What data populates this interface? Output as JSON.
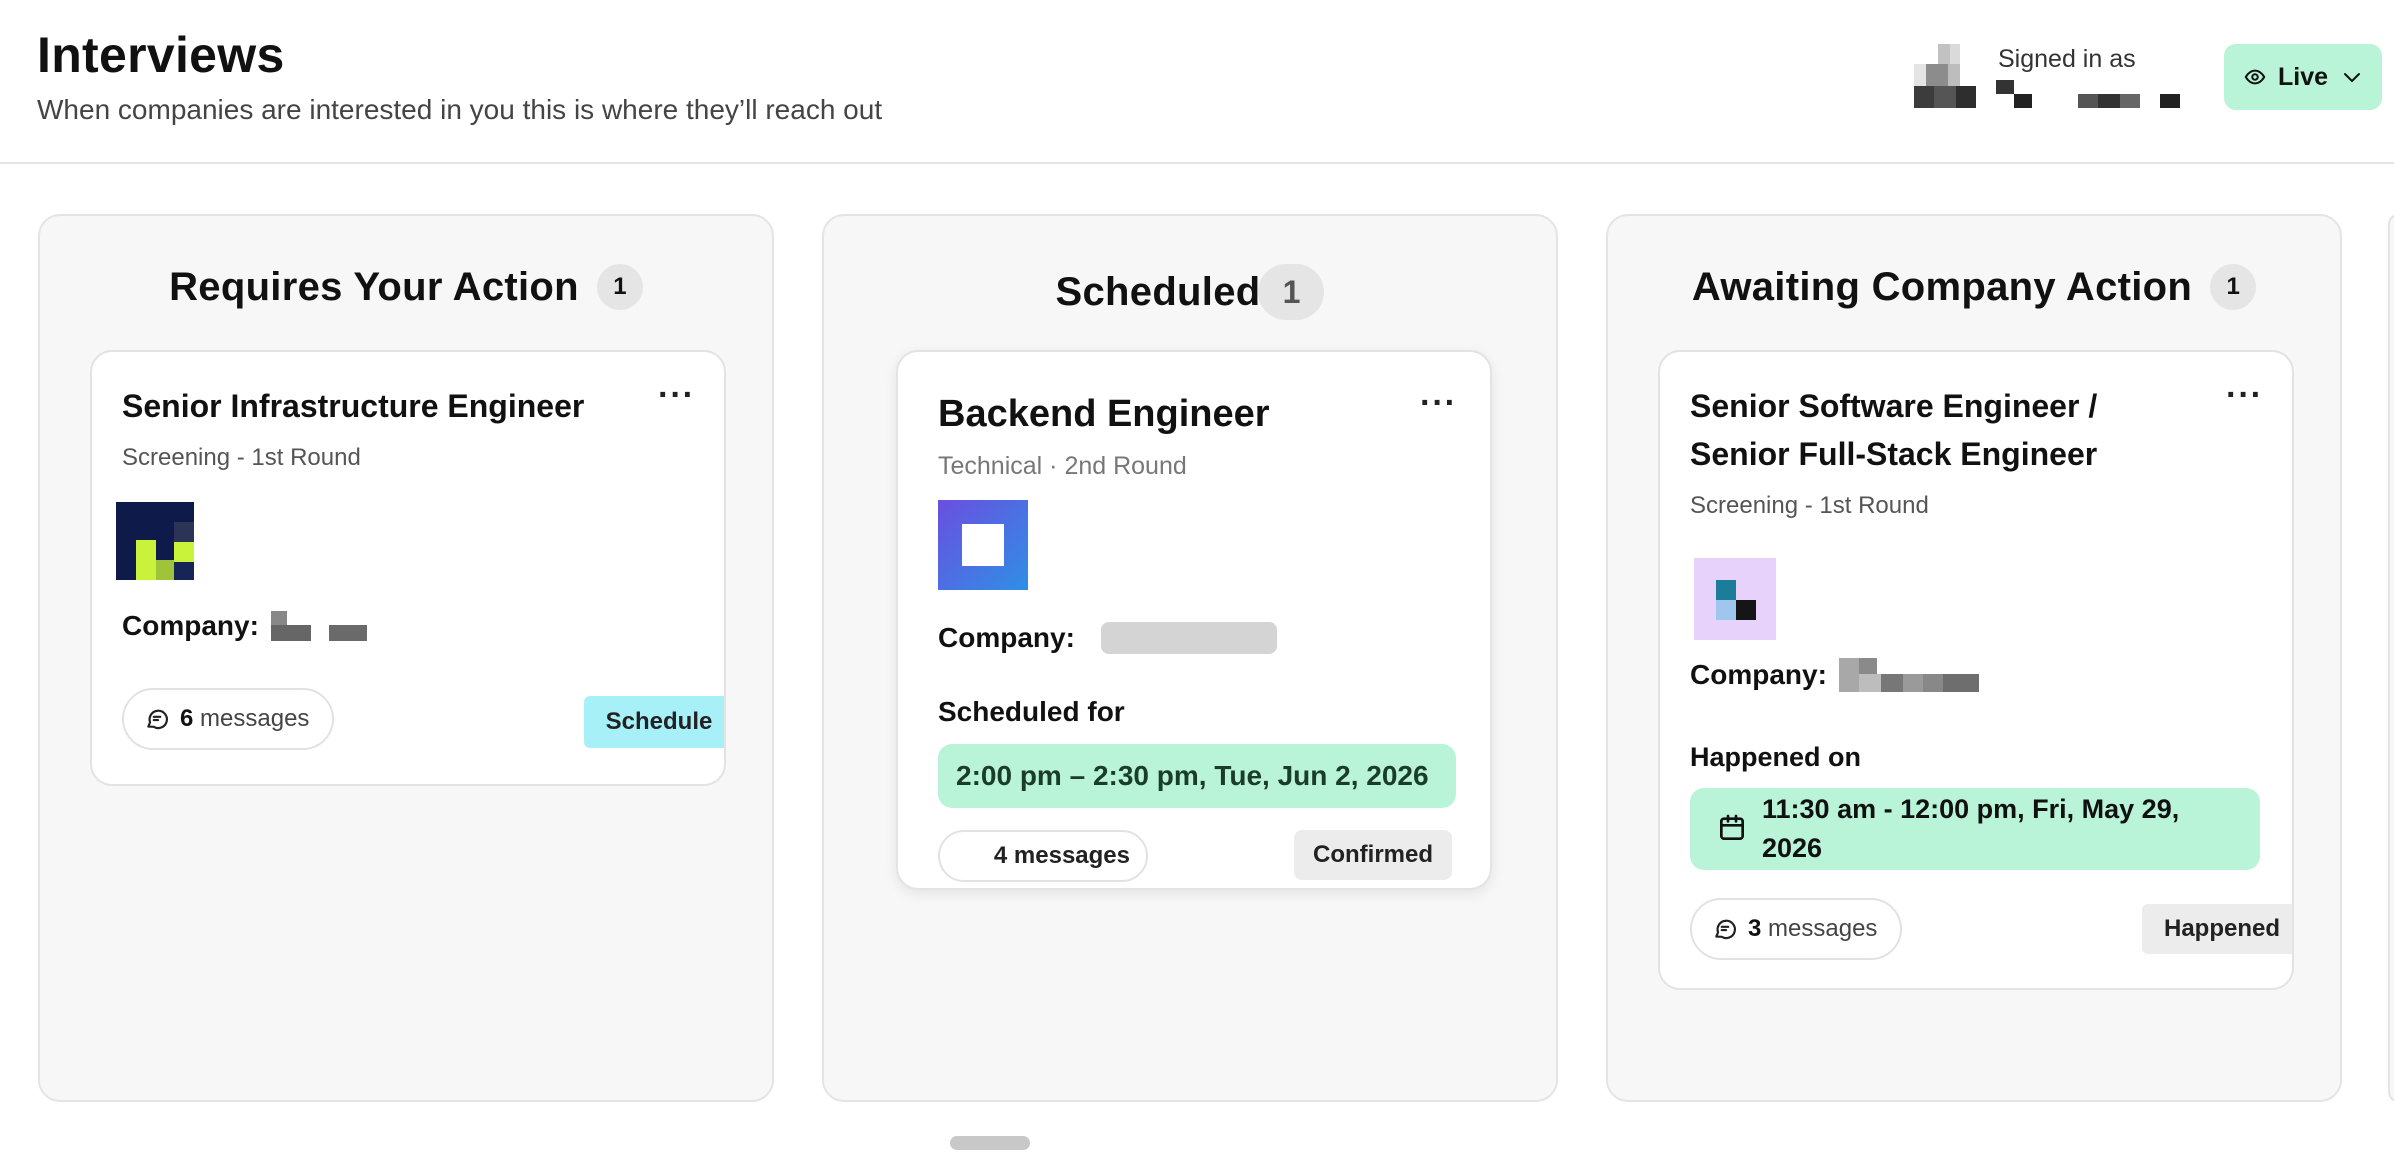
{
  "header": {
    "title": "Interviews",
    "subtitle": "When companies are interested in you this is where they’ll reach out",
    "signed_in_label": "Signed in as",
    "status_button": "Live"
  },
  "columns": [
    {
      "title": "Requires Your Action",
      "count": "1",
      "card": {
        "title": "Senior Infrastructure Engineer",
        "subtitle": "Screening - 1st Round",
        "company_label": "Company:",
        "message_count": "6",
        "message_word": "messages",
        "action_button": "Schedule"
      }
    },
    {
      "title": "Scheduled",
      "count": "1",
      "card": {
        "title": "Backend Engineer",
        "subtitle": "Technical · 2nd Round",
        "company_label": "Company:",
        "scheduled_label": "Scheduled for",
        "scheduled_time": "2:00 pm – 2:30 pm, Tue, Jun 2, 2026",
        "messages_text": "4 messages",
        "status": "Confirmed"
      }
    },
    {
      "title": "Awaiting Company Action",
      "count": "1",
      "card": {
        "title_line1": "Senior Software Engineer /",
        "title_line2": "Senior Full-Stack Engineer",
        "subtitle": "Screening - 1st Round",
        "company_label": "Company:",
        "happened_label": "Happened on",
        "happened_time_line1": "11:30 am - 12:00 pm, Fri, May 29,",
        "happened_time_line2": "2026",
        "message_count": "3",
        "message_word": "messages",
        "status": "Happened"
      }
    }
  ],
  "colors": {
    "live_green": "#b9f3d8",
    "schedule_cyan": "#a8f0f8",
    "tag_gray": "#ececec",
    "column_bg": "#f7f7f7"
  },
  "icons": {
    "status": "eye-icon",
    "dropdown": "chevron-down-icon",
    "messages": "chat-bubble-icon",
    "calendar": "calendar-icon",
    "more": "more-horizontal-icon"
  }
}
